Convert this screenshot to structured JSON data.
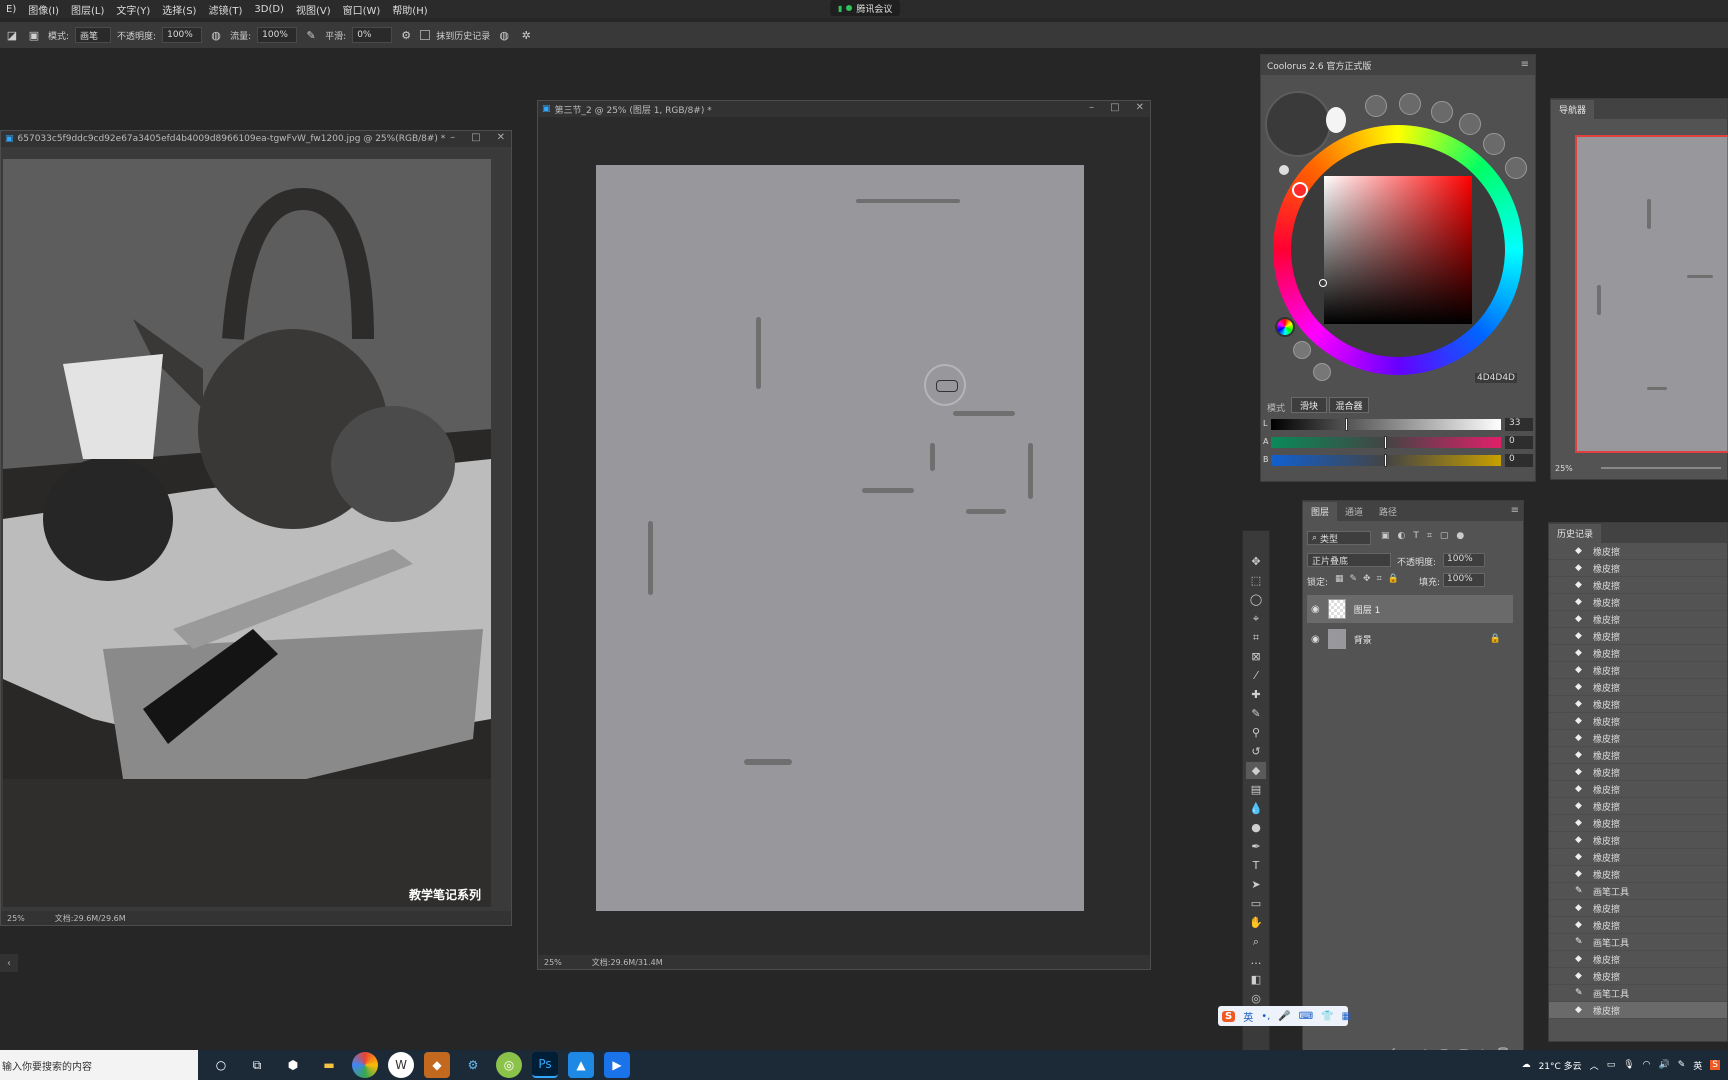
{
  "menubar": {
    "items": [
      "E)",
      "图像(I)",
      "图层(L)",
      "文字(Y)",
      "选择(S)",
      "滤镜(T)",
      "3D(D)",
      "视图(V)",
      "窗口(W)",
      "帮助(H)"
    ],
    "meeting_label": "腾讯会议"
  },
  "options": {
    "mode_label": "模式:",
    "mode_value": "画笔",
    "opacity_label": "不透明度:",
    "opacity_value": "100%",
    "flow_label": "流量:",
    "flow_value": "100%",
    "smooth_label": "平滑:",
    "smooth_value": "0%",
    "history_label": "抹到历史记录"
  },
  "doc1": {
    "title": "657033c5f9ddc9cd92e67a3405efd4b4009d8966109ea-tgwFvW_fw1200.jpg @ 25%(RGB/8#) *",
    "zoom": "25%",
    "size": "文档:29.6M/29.6M",
    "watermark": "教学笔记系列"
  },
  "doc2": {
    "title": "第三节_2 @ 25% (图层 1, RGB/8#) *",
    "zoom": "25%",
    "size": "文档:29.6M/31.4M"
  },
  "coolorus": {
    "title": "Coolorus 2.6 官方正式版",
    "hex": "4D4D4D",
    "mode_label": "模式",
    "btn_slider": "滑块",
    "btn_mixer": "混合器",
    "l_label": "L",
    "l_value": "33",
    "a_label": "A",
    "a_value": "0",
    "b_label": "B",
    "b_value": "0",
    "color_lightness": 0.33,
    "color_a": 0.5,
    "color_b": 0.5
  },
  "navigator": {
    "tab": "导航器",
    "zoom": "25%"
  },
  "layers": {
    "tabs": [
      "图层",
      "通道",
      "路径"
    ],
    "filter_label": "类型",
    "blend_mode": "正片叠底",
    "opacity_label": "不透明度:",
    "opacity_value": "100%",
    "lock_label": "锁定:",
    "fill_label": "填充:",
    "fill_value": "100%",
    "items": [
      {
        "name": "图层 1"
      },
      {
        "name": "背景"
      }
    ]
  },
  "history": {
    "tab": "历史记录",
    "items": [
      "橡皮擦",
      "橡皮擦",
      "橡皮擦",
      "橡皮擦",
      "橡皮擦",
      "橡皮擦",
      "橡皮擦",
      "橡皮擦",
      "橡皮擦",
      "橡皮擦",
      "橡皮擦",
      "橡皮擦",
      "橡皮擦",
      "橡皮擦",
      "橡皮擦",
      "橡皮擦",
      "橡皮擦",
      "橡皮擦",
      "橡皮擦",
      "橡皮擦",
      "画笔工具",
      "橡皮擦",
      "橡皮擦",
      "画笔工具",
      "橡皮擦",
      "橡皮擦",
      "画笔工具",
      "橡皮擦"
    ]
  },
  "ime": {
    "lang": "英"
  },
  "taskbar": {
    "search_placeholder": "输入你要搜索的内容",
    "weather": "21°C 多云",
    "lang": "英"
  },
  "colors": {
    "canvas": "#98979c",
    "ps_accent": "#31a8ff"
  }
}
